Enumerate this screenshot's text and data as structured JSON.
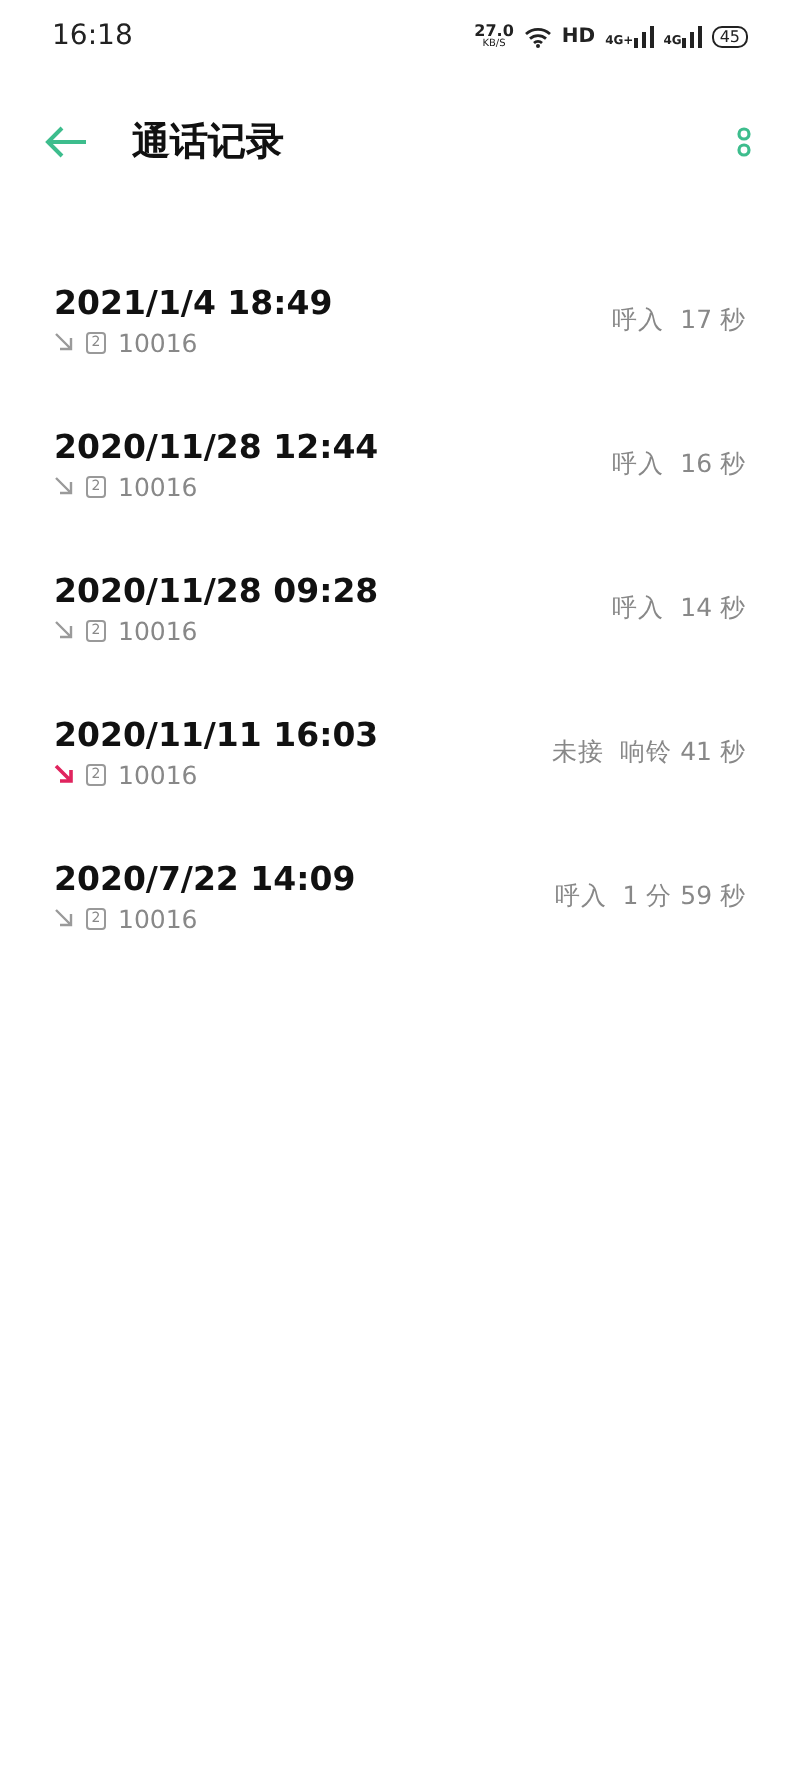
{
  "status_bar": {
    "time": "16:18",
    "speed": "27.0",
    "speed_unit": "KB/S",
    "hd": "HD",
    "network_1": "4G+",
    "network_2": "4G",
    "battery": "45"
  },
  "header": {
    "title": "通话记录"
  },
  "calls": [
    {
      "datetime": "2021/1/4 18:49",
      "kind": "incoming",
      "sim": "2",
      "number": "10016",
      "detail": "呼入  17 秒"
    },
    {
      "datetime": "2020/11/28 12:44",
      "kind": "incoming",
      "sim": "2",
      "number": "10016",
      "detail": "呼入  16 秒"
    },
    {
      "datetime": "2020/11/28 09:28",
      "kind": "incoming",
      "sim": "2",
      "number": "10016",
      "detail": "呼入  14 秒"
    },
    {
      "datetime": "2020/11/11 16:03",
      "kind": "missed",
      "sim": "2",
      "number": "10016",
      "detail": "未接  响铃 41 秒"
    },
    {
      "datetime": "2020/7/22 14:09",
      "kind": "incoming",
      "sim": "2",
      "number": "10016",
      "detail": "呼入  1 分 59 秒"
    }
  ]
}
